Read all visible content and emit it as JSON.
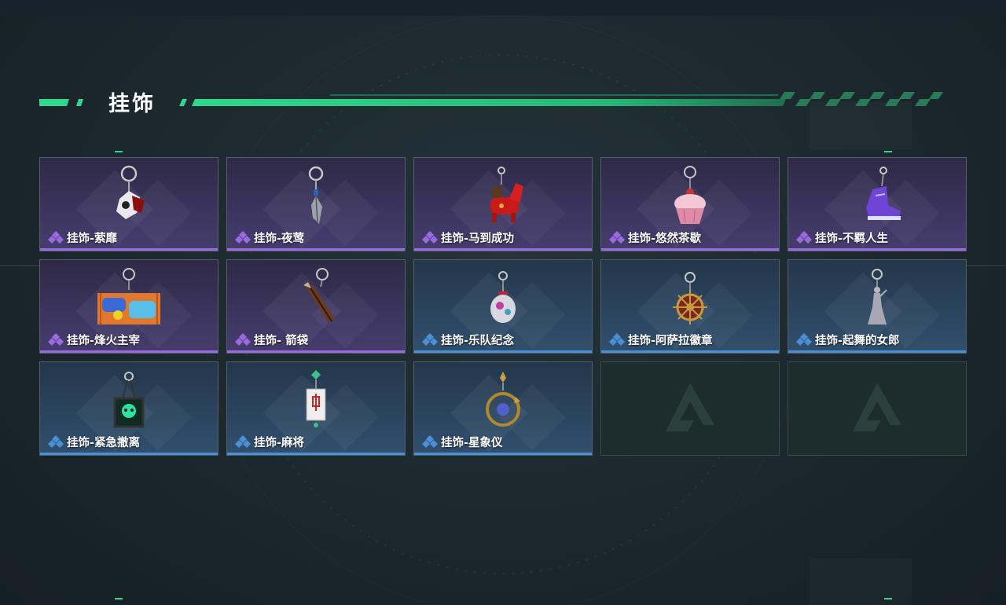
{
  "page": {
    "title": "挂饰"
  },
  "colors": {
    "accent": "#2fd88f",
    "epic": "#9a6be0",
    "rare": "#4b8fd6"
  },
  "items": [
    {
      "name": "挂饰-萦靡",
      "rarity": "epic",
      "icon": "bloody-flower-charm-icon"
    },
    {
      "name": "挂饰-夜莺",
      "rarity": "epic",
      "icon": "feather-charm-icon"
    },
    {
      "name": "挂饰-马到成功",
      "rarity": "epic",
      "icon": "red-horse-charm-icon"
    },
    {
      "name": "挂饰-悠然茶歇",
      "rarity": "epic",
      "icon": "cupcake-charm-icon"
    },
    {
      "name": "挂饰-不羁人生",
      "rarity": "epic",
      "icon": "sneaker-charm-icon"
    },
    {
      "name": "挂饰-烽火主宰",
      "rarity": "epic",
      "icon": "graffiti-container-charm-icon"
    },
    {
      "name": "挂饰- 箭袋",
      "rarity": "epic",
      "icon": "quiver-charm-icon"
    },
    {
      "name": "挂饰-乐队纪念",
      "rarity": "rare",
      "icon": "band-badge-charm-icon"
    },
    {
      "name": "挂饰-阿萨拉徽章",
      "rarity": "rare",
      "icon": "ship-wheel-badge-charm-icon"
    },
    {
      "name": "挂饰-起舞的女郎",
      "rarity": "rare",
      "icon": "dancer-figurine-charm-icon"
    },
    {
      "name": "挂饰-紧急撤离",
      "rarity": "rare",
      "icon": "green-skull-tag-charm-icon"
    },
    {
      "name": "挂饰-麻将",
      "rarity": "rare",
      "icon": "mahjong-tile-charm-icon"
    },
    {
      "name": "挂饰-星象仪",
      "rarity": "rare",
      "icon": "astrolabe-charm-icon"
    }
  ],
  "empty_slots": 2
}
